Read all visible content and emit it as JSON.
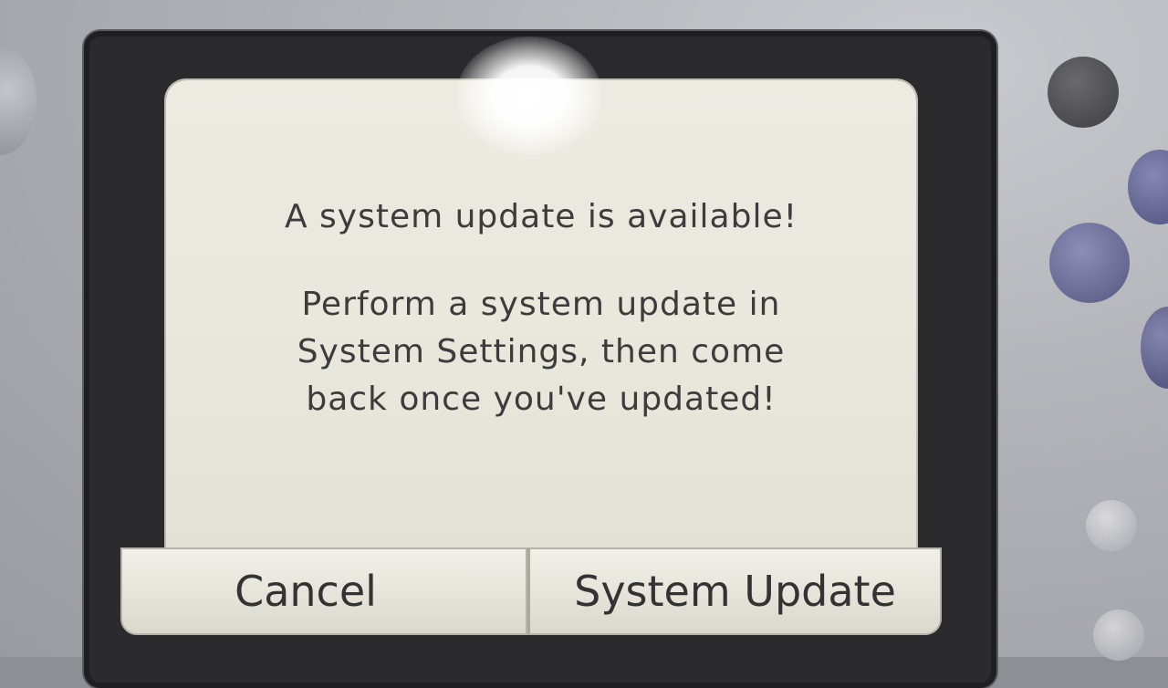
{
  "dialog": {
    "headline": "A system update is available!",
    "body_lines": [
      "Perform a system update in",
      "System Settings, then come",
      "back once you've updated!"
    ]
  },
  "buttons": {
    "cancel_label": "Cancel",
    "update_label": "System Update"
  },
  "colors": {
    "dialog_background": "#e8e7dc",
    "text": "#3c3c3c",
    "device_body": "#b3b4b9",
    "action_buttons": "#55577f"
  }
}
